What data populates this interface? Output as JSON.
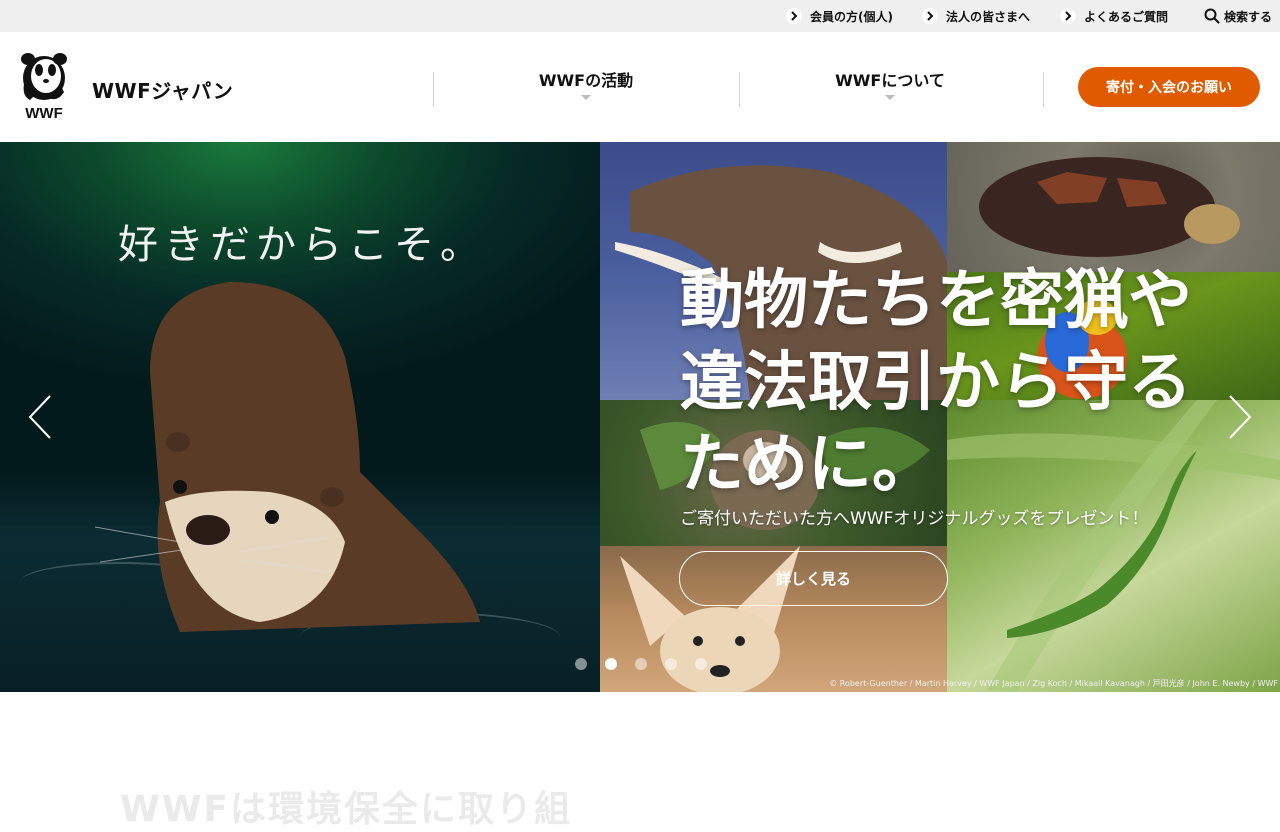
{
  "utility_links": [
    {
      "label": "会員の方(個人)"
    },
    {
      "label": "法人の皆さまへ"
    },
    {
      "label": "よくあるご質問"
    }
  ],
  "search_label": "検索する",
  "brand": {
    "name": "WWFジャパン",
    "logo_text": "WWF"
  },
  "nav": [
    {
      "label": "WWFの活動"
    },
    {
      "label": "WWFについて"
    }
  ],
  "donate_label": "寄付・入会のお願い",
  "hero": {
    "tagline": "好きだからこそ。",
    "headline": "動物たちを密猟や違法取引から守るために。",
    "subtext": "ご寄付いただいた方へWWFオリジナルグッズをプレゼント！",
    "button_label": "詳しく見る",
    "credit": "© Robert-Guenther / Martin Harvey / WWF Japan / Zig Koch / Mikaail Kavanagh / 戸田光彦 / John E. Newby / WWF",
    "slide_count": 5,
    "active_slide": 2
  },
  "section_teaser": "WWFは環境保全に取り組"
}
